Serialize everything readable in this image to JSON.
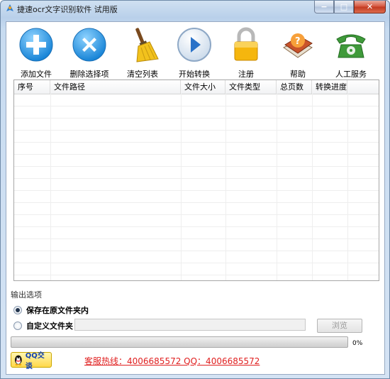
{
  "window": {
    "title": "捷速ocr文字识别软件 试用版",
    "minimize_glyph": "−",
    "maximize_glyph": "□",
    "close_glyph": "✕"
  },
  "toolbar": {
    "items": [
      {
        "label": "添加文件",
        "icon": "add-circle-icon"
      },
      {
        "label": "删除选择项",
        "icon": "delete-circle-icon"
      },
      {
        "label": "清空列表",
        "icon": "broom-icon"
      },
      {
        "label": "开始转换",
        "icon": "play-icon"
      },
      {
        "label": "注册",
        "icon": "lock-icon"
      },
      {
        "label": "帮助",
        "icon": "help-book-icon"
      },
      {
        "label": "人工服务",
        "icon": "telephone-icon"
      }
    ]
  },
  "table": {
    "columns": [
      "序号",
      "文件路径",
      "文件大小",
      "文件类型",
      "总页数",
      "转换进度"
    ]
  },
  "output": {
    "group_label": "输出选项",
    "option_original": "保存在原文件夹内",
    "option_custom": "自定义文件夹",
    "path_value": "",
    "browse_label": "浏览"
  },
  "progress": {
    "value_percent": 0,
    "label": "0%"
  },
  "footer": {
    "qq_label": "QQ交谈",
    "hotline": "客服热线：4006685572 QQ：4006685572"
  },
  "colors": {
    "hotline": "#e02020",
    "accent_blue": "#2a8ed8",
    "progress_green": "#3cb33a"
  }
}
